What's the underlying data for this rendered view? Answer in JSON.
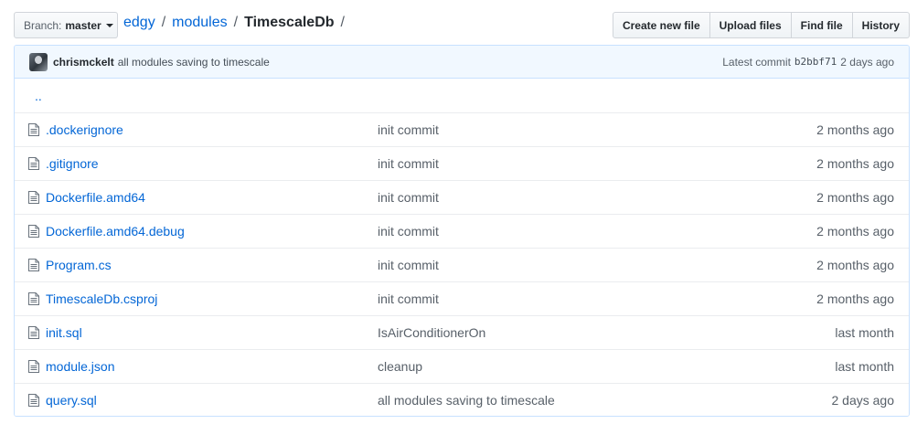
{
  "branch": {
    "label": "Branch:",
    "value": "master"
  },
  "breadcrumb": {
    "repo": "edgy",
    "dir": "modules",
    "current": "TimescaleDb",
    "separator": "/"
  },
  "actions": {
    "create": "Create new file",
    "upload": "Upload files",
    "find": "Find file",
    "history": "History"
  },
  "commit": {
    "author": "chrismckelt",
    "message": "all modules saving to timescale",
    "latest_label": "Latest commit",
    "sha": "b2bbf71",
    "age": "2 days ago"
  },
  "parent_dir": "..",
  "files": [
    {
      "name": ".dockerignore",
      "message": "init commit",
      "age": "2 months ago"
    },
    {
      "name": ".gitignore",
      "message": "init commit",
      "age": "2 months ago"
    },
    {
      "name": "Dockerfile.amd64",
      "message": "init commit",
      "age": "2 months ago"
    },
    {
      "name": "Dockerfile.amd64.debug",
      "message": "init commit",
      "age": "2 months ago"
    },
    {
      "name": "Program.cs",
      "message": "init commit",
      "age": "2 months ago"
    },
    {
      "name": "TimescaleDb.csproj",
      "message": "init commit",
      "age": "2 months ago"
    },
    {
      "name": "init.sql",
      "message": "IsAirConditionerOn",
      "age": "last month"
    },
    {
      "name": "module.json",
      "message": "cleanup",
      "age": "last month"
    },
    {
      "name": "query.sql",
      "message": "all modules saving to timescale",
      "age": "2 days ago"
    }
  ],
  "icons": {
    "file": "file-icon",
    "caret": "caret-down-icon",
    "avatar": "avatar"
  },
  "colors": {
    "link": "#0366d6",
    "commit_bar": "#f1f8ff",
    "border": "#c8e1ff"
  }
}
